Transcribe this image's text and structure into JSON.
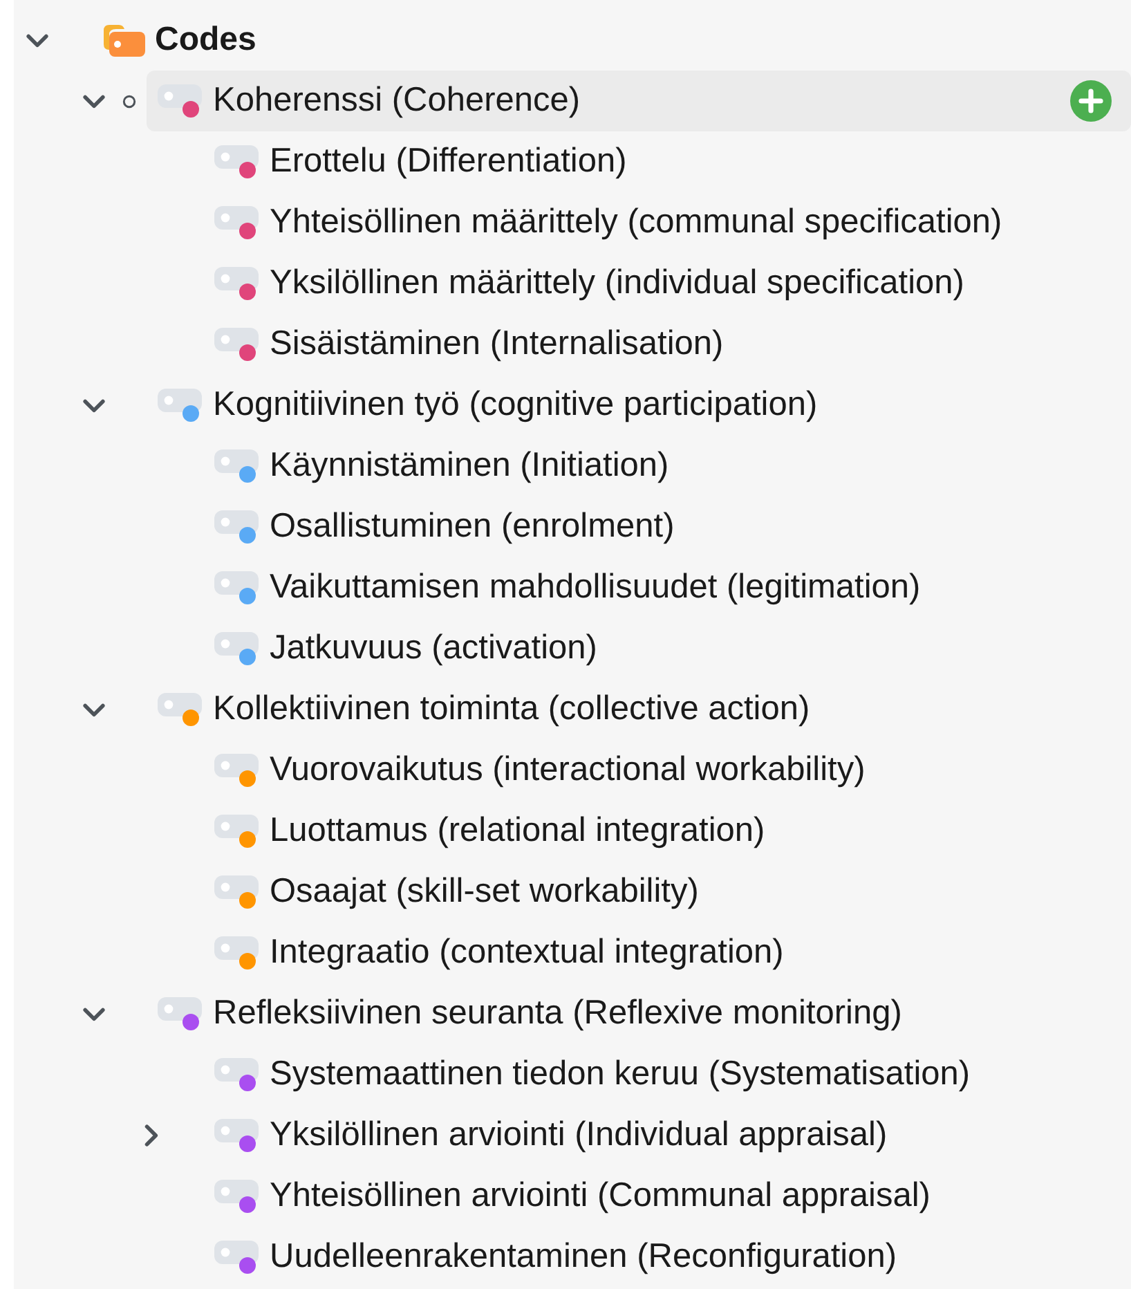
{
  "tree": {
    "label": "Codes",
    "expanded": true,
    "children": [
      {
        "label": "Koherenssi (Coherence)",
        "color": "#e0457b",
        "expanded": true,
        "selected": true,
        "children": [
          {
            "label": "Erottelu (Differentiation)",
            "color": "#e0457b",
            "selected": false
          },
          {
            "label": "Yhteisöllinen määrittely (communal specification)",
            "color": "#e0457b",
            "selected": false
          },
          {
            "label": "Yksilöllinen määrittely (individual specification)",
            "color": "#e0457b",
            "selected": false
          },
          {
            "label": "Sisäistäminen (Internalisation)",
            "color": "#e0457b",
            "selected": false
          }
        ]
      },
      {
        "label": "Kognitiivinen työ (cognitive participation)",
        "color": "#5aaaf5",
        "expanded": true,
        "selected": false,
        "children": [
          {
            "label": "Käynnistäminen (Initiation)",
            "color": "#5aaaf5",
            "selected": false
          },
          {
            "label": "Osallistuminen (enrolment)",
            "color": "#5aaaf5",
            "selected": false
          },
          {
            "label": "Vaikuttamisen mahdollisuudet (legitimation)",
            "color": "#5aaaf5",
            "selected": false
          },
          {
            "label": "Jatkuvuus (activation)",
            "color": "#5aaaf5",
            "selected": false
          }
        ]
      },
      {
        "label": "Kollektiivinen toiminta (collective action)",
        "color": "#ff9500",
        "expanded": true,
        "selected": false,
        "children": [
          {
            "label": "Vuorovaikutus (interactional workability)",
            "color": "#ff9500",
            "selected": false
          },
          {
            "label": "Luottamus (relational integration)",
            "color": "#ff9500",
            "selected": false
          },
          {
            "label": "Osaajat (skill-set workability)",
            "color": "#ff9500",
            "selected": false
          },
          {
            "label": "Integraatio (contextual integration)",
            "color": "#ff9500",
            "selected": false
          }
        ]
      },
      {
        "label": "Refleksiivinen seuranta (Reflexive monitoring)",
        "color": "#a94ef0",
        "expanded": true,
        "selected": false,
        "children": [
          {
            "label": "Systemaattinen tiedon keruu (Systematisation)",
            "color": "#a94ef0",
            "selected": false
          },
          {
            "label": "Yksilöllinen arviointi (Individual appraisal)",
            "color": "#a94ef0",
            "expanded": false,
            "selected": false
          },
          {
            "label": "Yhteisöllinen arviointi (Communal appraisal)",
            "color": "#a94ef0",
            "selected": false
          },
          {
            "label": "Uudelleenrakentaminen (Reconfiguration)",
            "color": "#a94ef0",
            "selected": false
          }
        ]
      }
    ]
  }
}
